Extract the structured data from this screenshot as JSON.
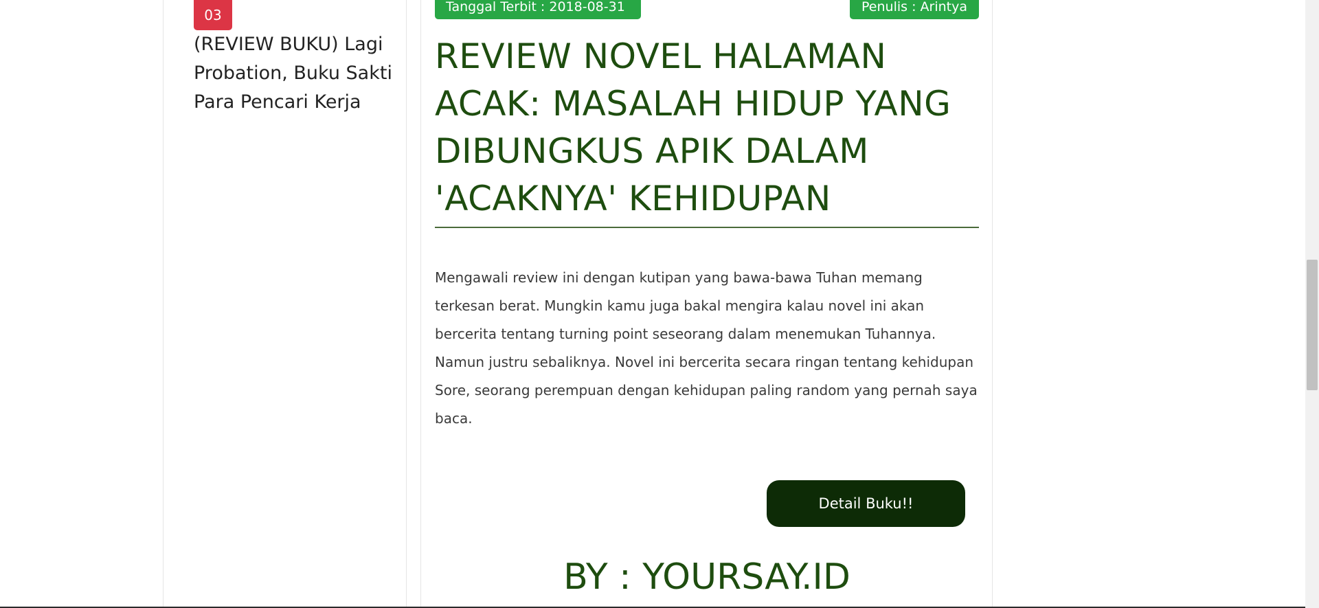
{
  "sidebar": {
    "rank": "03",
    "article_title": "(REVIEW BUKU) Lagi Probation, Buku Sakti Para Pencari Kerja"
  },
  "article": {
    "date_label": "Tanggal Terbit : 2018-08-31",
    "author_label": "Penulis : Arintya",
    "title": "REVIEW NOVEL HALAMAN ACAK: MASALAH HIDUP YANG DIBUNGKUS APIK DALAM 'ACAKNYA' KEHIDUPAN",
    "excerpt": "Mengawali review ini dengan kutipan yang bawa-bawa Tuhan memang terkesan berat. Mungkin kamu juga bakal mengira kalau novel ini akan bercerita tentang turning point seseorang dalam menemukan Tuhannya. Namun justru sebaliknya. Novel ini bercerita secara ringan tentang kehidupan Sore, seorang perempuan dengan kehidupan paling random yang pernah saya baca.",
    "detail_button_label": "Detail Buku!!",
    "source_credit": "BY : YOURSAY.ID"
  },
  "colors": {
    "badge_red": "#dc3545",
    "meta_green": "#28a745",
    "title_green": "#1e4d0f",
    "button_dark_green": "#0d2b06"
  }
}
